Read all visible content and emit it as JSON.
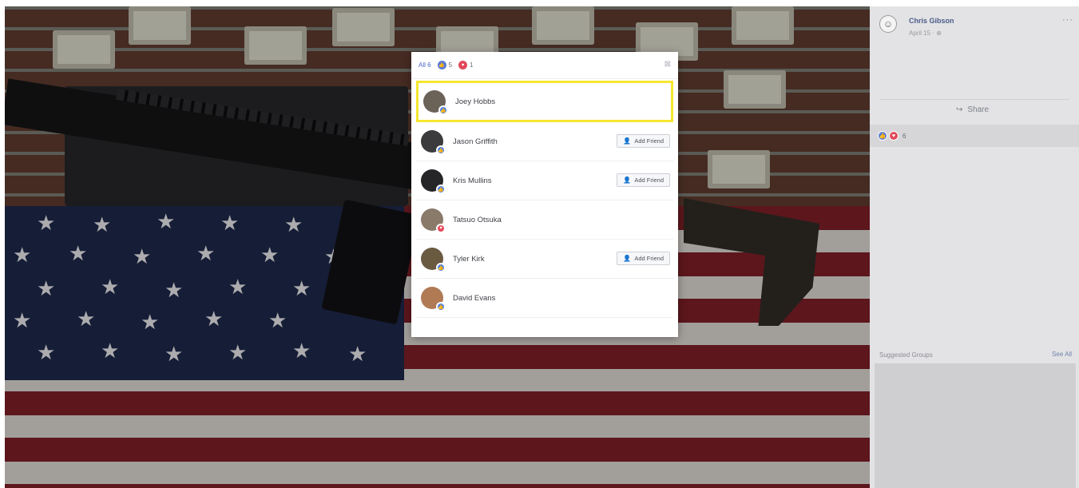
{
  "post": {
    "author": "Chris Gibson",
    "date": "April 15 · ⊕",
    "more": "···",
    "share_label": "Share",
    "reaction_count": "6"
  },
  "reactions_modal": {
    "tabs": [
      {
        "label": "All 6",
        "type": "all"
      },
      {
        "label": "5",
        "type": "like"
      },
      {
        "label": "1",
        "type": "love"
      }
    ],
    "close_icon": "⊠",
    "users": [
      {
        "name": "Joey Hobbs",
        "reaction": "like",
        "add_friend": false,
        "selected": true,
        "avatar_color": "#6b6258"
      },
      {
        "name": "Jason Griffith",
        "reaction": "like",
        "add_friend": true,
        "selected": false,
        "avatar_color": "#3b3a3c"
      },
      {
        "name": "Kris Mullins",
        "reaction": "like",
        "add_friend": true,
        "selected": false,
        "avatar_color": "#262628"
      },
      {
        "name": "Tatsuo Otsuka",
        "reaction": "love",
        "add_friend": false,
        "selected": false,
        "avatar_color": "#8a7a6a"
      },
      {
        "name": "Tyler Kirk",
        "reaction": "like",
        "add_friend": true,
        "selected": false,
        "avatar_color": "#6a5a40"
      },
      {
        "name": "David Evans",
        "reaction": "like",
        "add_friend": false,
        "selected": false,
        "avatar_color": "#b07a55"
      }
    ],
    "add_friend_label": "Add Friend"
  },
  "suggested_groups": {
    "label": "Suggested Groups",
    "see_all": "See All"
  },
  "colors": {
    "like": "#4d7fe8",
    "love": "#e8475b",
    "highlight": "#f5e72f"
  }
}
